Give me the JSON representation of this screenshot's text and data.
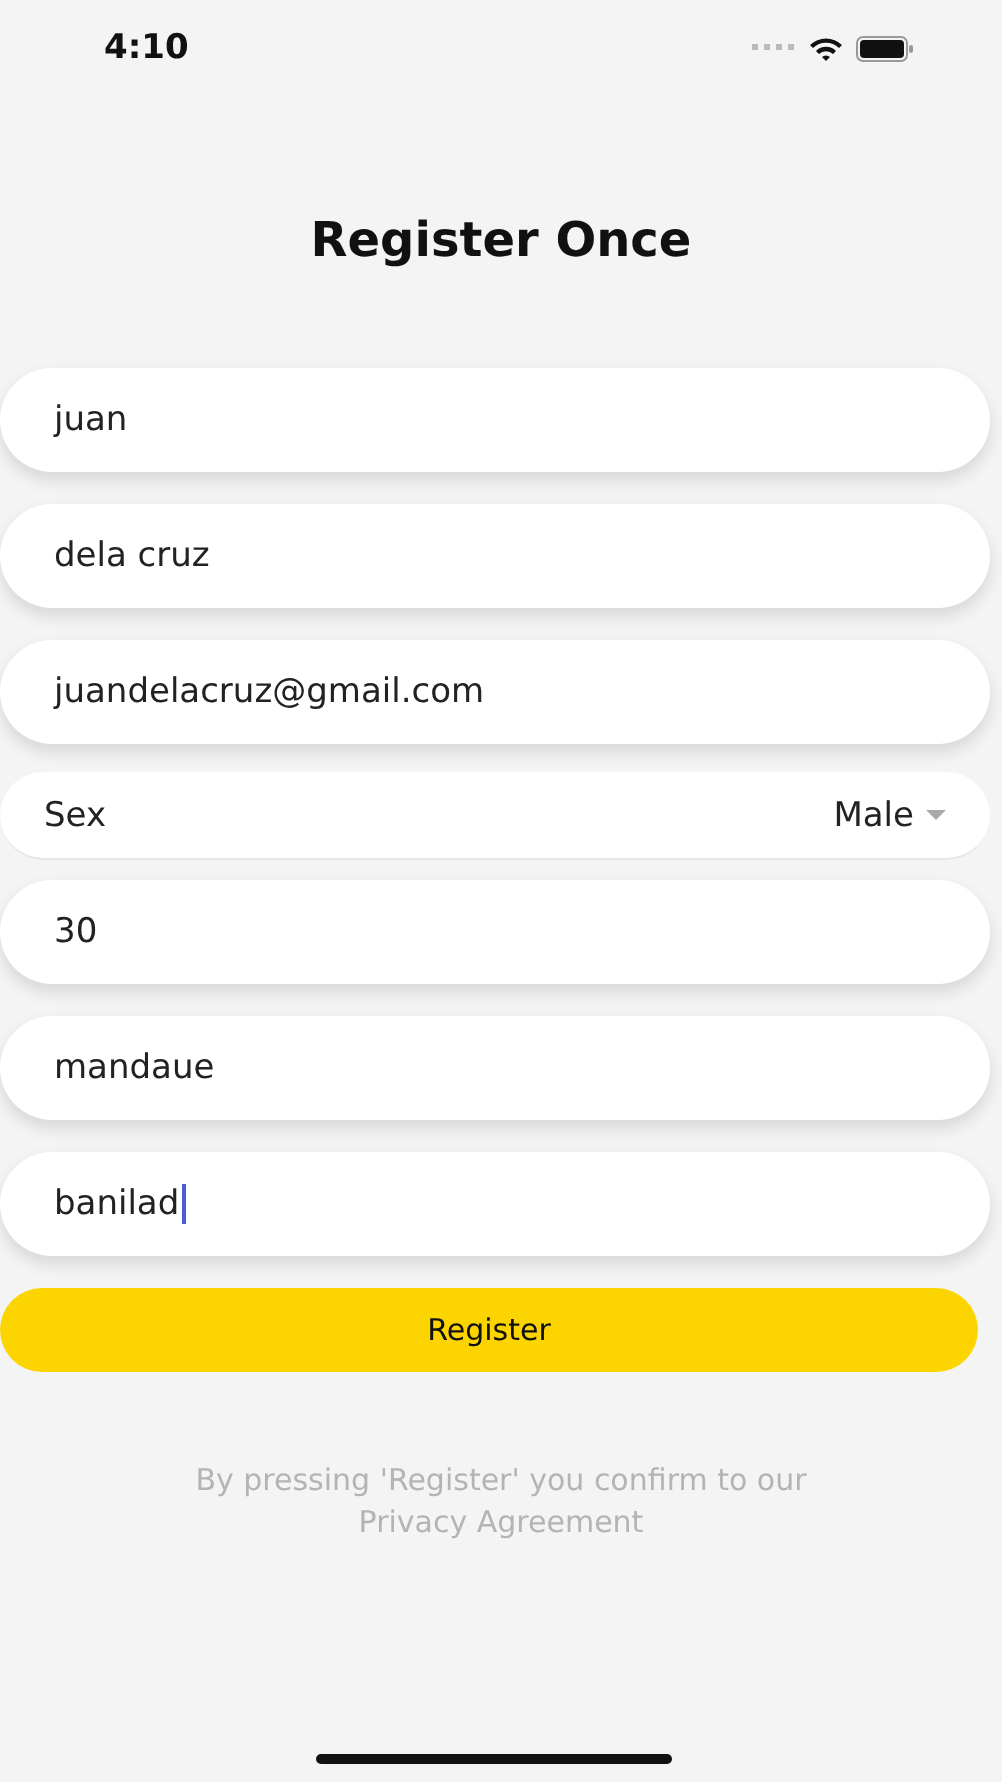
{
  "status_bar": {
    "time": "4:10"
  },
  "title": "Register Once",
  "fields": [
    {
      "kind": "text",
      "value": "juan",
      "focused": false
    },
    {
      "kind": "text",
      "value": "dela cruz",
      "focused": false
    },
    {
      "kind": "text",
      "value": "juandelacruz@gmail.com",
      "focused": false
    },
    {
      "kind": "select",
      "label": "Sex",
      "value": "Male"
    },
    {
      "kind": "text",
      "value": "30",
      "focused": false
    },
    {
      "kind": "text",
      "value": "mandaue",
      "focused": false
    },
    {
      "kind": "text",
      "value": "banilad",
      "focused": true
    }
  ],
  "button": "Register",
  "note": "By pressing 'Register' you confirm to our Privacy Agreement"
}
